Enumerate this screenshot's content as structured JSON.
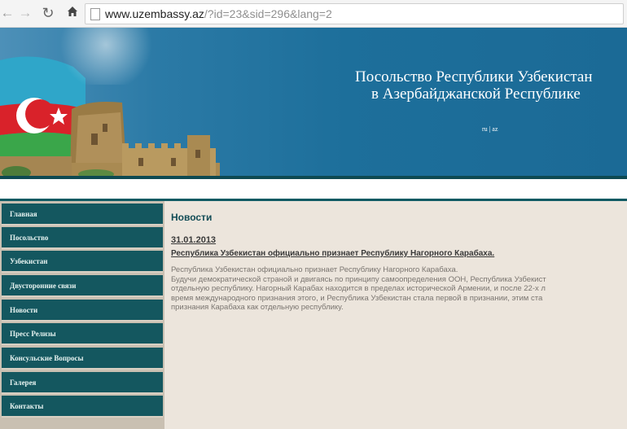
{
  "browser": {
    "url_host": "www.uzembassy.az",
    "url_path": "/?id=23&sid=296&lang=2",
    "icons": [
      "back-icon",
      "forward-icon",
      "reload-icon",
      "home-icon",
      "page-icon"
    ]
  },
  "banner": {
    "title_line1": "Посольство Республики Узбекистан",
    "title_line2": "в Азербайджанской Республике",
    "languages": "ru | az"
  },
  "sidebar": {
    "items": [
      {
        "label": "Главная"
      },
      {
        "label": "Посольство"
      },
      {
        "label": "Узбекистан"
      },
      {
        "label": "Двусторонние связи"
      },
      {
        "label": "Новости"
      },
      {
        "label": "Пресс Релизы"
      },
      {
        "label": "Консульские Вопросы"
      },
      {
        "label": "Галерея"
      },
      {
        "label": "Контакты"
      }
    ]
  },
  "main": {
    "heading": "Новости",
    "date": "31.01.2013",
    "title": "Республика Узбекистан официально признает Республику Нагорного Карабаха.",
    "body": [
      "Республика Узбекистан официально признает Республику Нагорного Карабаха.",
      "Будучи демократической страной и двигаясь по принципу самоопределения ООН, Республика Узбекист",
      "отдельную республику. Нагорный Карабах находится в пределах исторической Армении, и после 22-х л",
      "время международного признания этого, и Республика Узбекистан стала первой в признании, этим ста",
      "признания Карабаха как отдельную республику."
    ]
  },
  "colors": {
    "menu_bg": "#14575f",
    "content_bg": "#ece5dc",
    "banner_blue": "#1d6f9b"
  }
}
